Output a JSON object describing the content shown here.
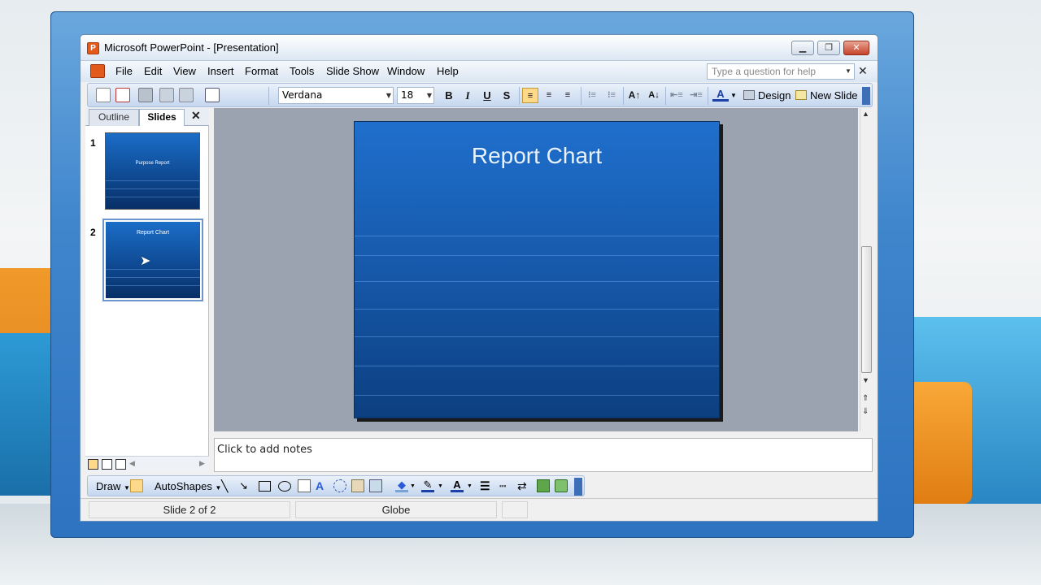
{
  "window": {
    "title": "Microsoft PowerPoint - [Presentation]",
    "app_icon": "powerpoint-icon",
    "controls": [
      "minimize-icon",
      "restore-icon",
      "close-icon"
    ]
  },
  "menu": {
    "items": [
      "File",
      "Edit",
      "View",
      "Insert",
      "Format",
      "Tools",
      "Slide Show",
      "Window",
      "Help"
    ],
    "help_placeholder": "Type a question for help"
  },
  "toolbar": {
    "font": "Verdana",
    "size": "18",
    "bold": "B",
    "italic": "I",
    "underline": "U",
    "shadow": "S",
    "design_label": "Design",
    "new_slide_label": "New Slide"
  },
  "panel": {
    "tabs": [
      "Outline",
      "Slides"
    ],
    "slides": [
      {
        "number": "1",
        "title": "Purpose Report"
      },
      {
        "number": "2",
        "title": "Report Chart"
      }
    ]
  },
  "slide": {
    "title": "Report Chart"
  },
  "notes": {
    "placeholder": "Click to add notes"
  },
  "drawing": {
    "draw_label": "Draw",
    "autoshapes_label": "AutoShapes"
  },
  "status": {
    "slide_info": "Slide 2 of 2",
    "design_name": "Globe"
  },
  "colors": {
    "accent": "#1f6fcc",
    "selected_tool": "#ffd98a"
  }
}
